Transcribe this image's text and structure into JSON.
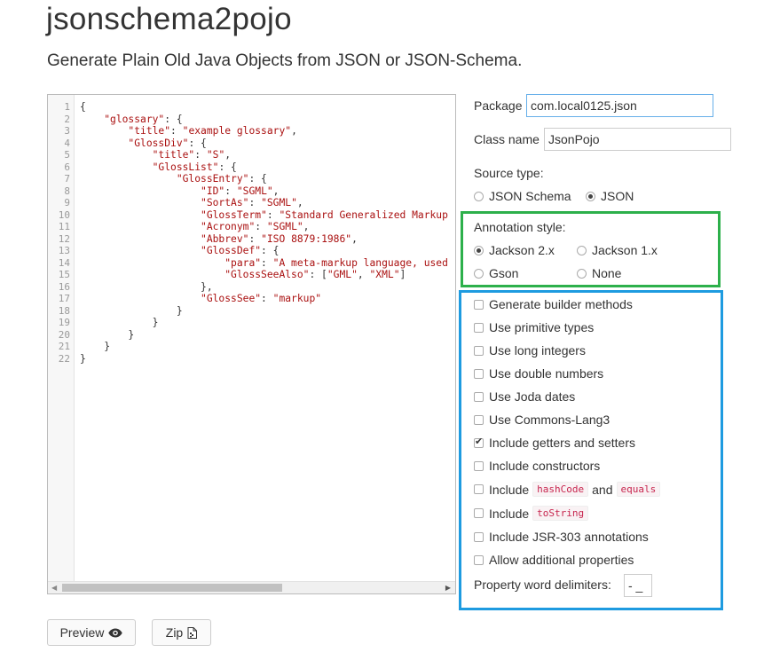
{
  "app": {
    "title": "jsonschema2pojo",
    "subtitle": "Generate Plain Old Java Objects from JSON or JSON-Schema."
  },
  "editor": {
    "lines": [
      "{",
      "    \"glossary\": {",
      "        \"title\": \"example glossary\",",
      "        \"GlossDiv\": {",
      "            \"title\": \"S\",",
      "            \"GlossList\": {",
      "                \"GlossEntry\": {",
      "                    \"ID\": \"SGML\",",
      "                    \"SortAs\": \"SGML\",",
      "                    \"GlossTerm\": \"Standard Generalized Markup",
      "                    \"Acronym\": \"SGML\",",
      "                    \"Abbrev\": \"ISO 8879:1986\",",
      "                    \"GlossDef\": {",
      "                        \"para\": \"A meta-markup language, used",
      "                        \"GlossSeeAlso\": [\"GML\", \"XML\"]",
      "                    },",
      "                    \"GlossSee\": \"markup\"",
      "                }",
      "            }",
      "        }",
      "    }",
      "}"
    ]
  },
  "form": {
    "package_label": "Package",
    "package_value": "com.local0125.json",
    "classname_label": "Class name",
    "classname_value": "JsonPojo",
    "source_type_label": "Source type:",
    "source_types": [
      {
        "label": "JSON Schema",
        "checked": false
      },
      {
        "label": "JSON",
        "checked": true
      }
    ],
    "annotation_label": "Annotation style:",
    "annotations": [
      {
        "label": "Jackson 2.x",
        "checked": true
      },
      {
        "label": "Jackson 1.x",
        "checked": false
      },
      {
        "label": "Gson",
        "checked": false
      },
      {
        "label": "None",
        "checked": false
      }
    ],
    "options": {
      "builder": {
        "label": "Generate builder methods",
        "checked": false
      },
      "primitive": {
        "label": "Use primitive types",
        "checked": false
      },
      "long_int": {
        "label": "Use long integers",
        "checked": false
      },
      "double_num": {
        "label": "Use double numbers",
        "checked": false
      },
      "joda": {
        "label": "Use Joda dates",
        "checked": false
      },
      "commons": {
        "label": "Use Commons-Lang3",
        "checked": false
      },
      "getters": {
        "label": "Include getters and setters",
        "checked": true
      },
      "constructors": {
        "label": "Include constructors",
        "checked": false
      },
      "hashcode": {
        "label_prefix": "Include",
        "code1": "hashCode",
        "label_mid": "and",
        "code2": "equals",
        "checked": false
      },
      "tostring": {
        "label_prefix": "Include",
        "code1": "toString",
        "checked": false
      },
      "jsr303": {
        "label": "Include JSR-303 annotations",
        "checked": false
      },
      "additional": {
        "label": "Allow additional properties",
        "checked": false
      }
    },
    "delimiters_label": "Property word delimiters:",
    "delimiters_value": "- _"
  },
  "buttons": {
    "preview": "Preview",
    "zip": "Zip"
  },
  "colors": {
    "annotation_box": "#2db04b",
    "options_box": "#1e9be0"
  },
  "icons": {
    "preview": "eye-icon",
    "zip": "file-icon"
  }
}
